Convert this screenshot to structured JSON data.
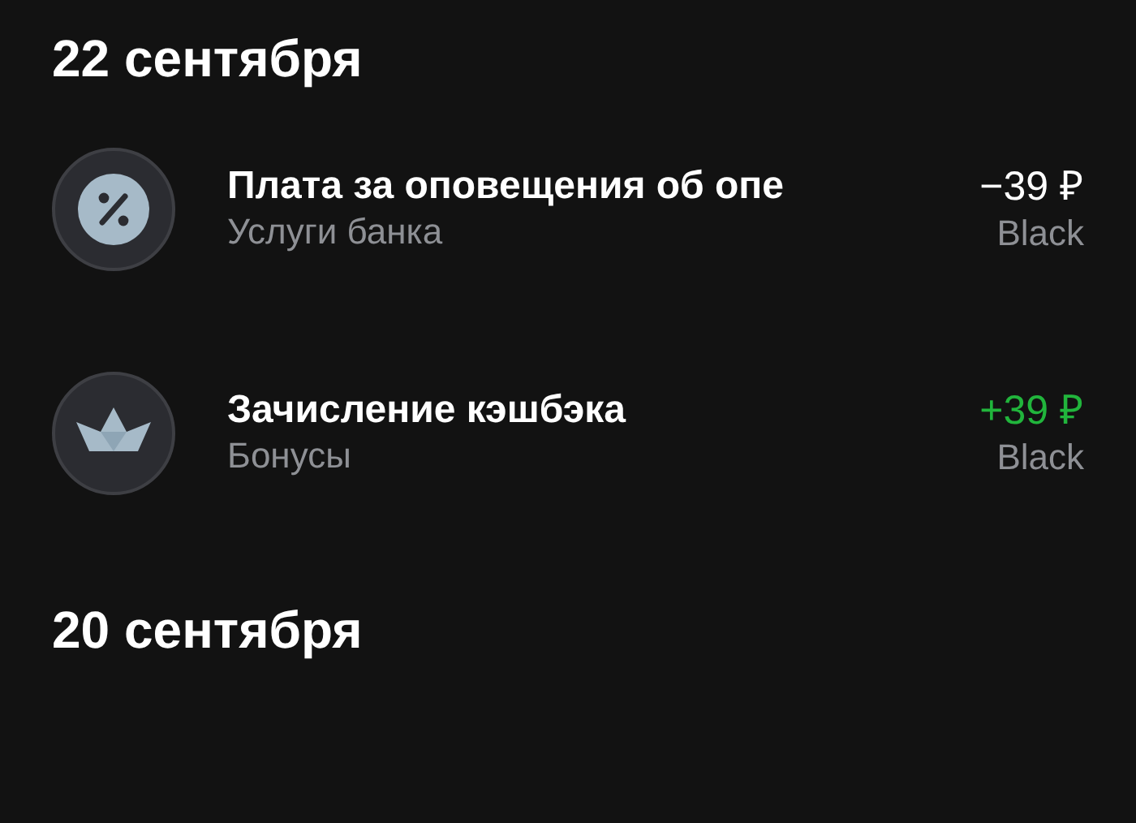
{
  "groups": [
    {
      "date": "22 сентября",
      "operations": [
        {
          "title": "Плата за оповещения об опе",
          "category": "Услуги банка",
          "amount": "−39 ₽",
          "kind": "debit",
          "card": "Black"
        },
        {
          "title": "Зачисление кэшбэка",
          "category": "Бонусы",
          "amount": "+39 ₽",
          "kind": "credit",
          "card": "Black"
        }
      ]
    },
    {
      "date": "20 сентября"
    }
  ]
}
